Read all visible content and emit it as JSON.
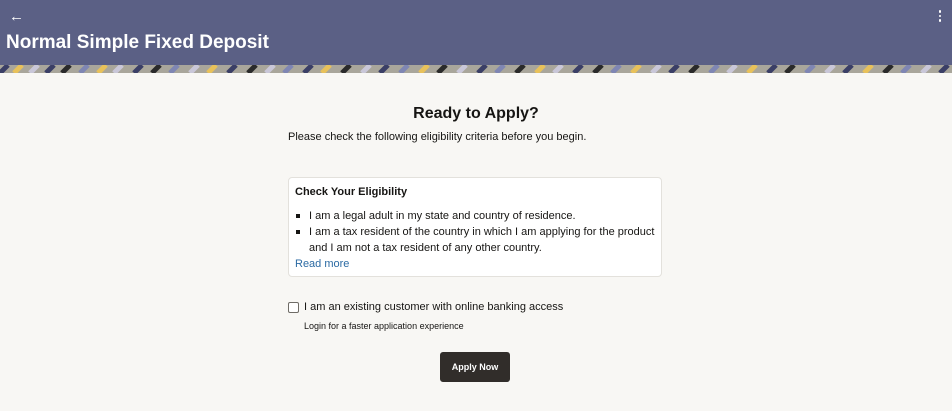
{
  "header": {
    "back_icon": "arrow-left-icon",
    "menu_icon": "kebab-vertical-icon",
    "title": "Normal Simple Fixed Deposit",
    "background": "#5b6085"
  },
  "main": {
    "heading": "Ready to Apply?",
    "subheading": "Please check the following eligibility criteria before you begin.",
    "eligibility": {
      "title": "Check Your Eligibility",
      "items": [
        "I am a legal adult in my state and country of residence.",
        "I am a tax resident of the country in which I am applying for the product and I am not a tax resident of any other country."
      ],
      "read_more": "Read more"
    },
    "existing_customer": {
      "label": "I am an existing customer with online banking access",
      "hint": "Login for a faster application experience",
      "checked": false
    },
    "apply_button": "Apply Now"
  },
  "colors": {
    "accent_dark": "#312d2a",
    "link": "#2b6aa3",
    "page_background": "#f8f7f4"
  }
}
